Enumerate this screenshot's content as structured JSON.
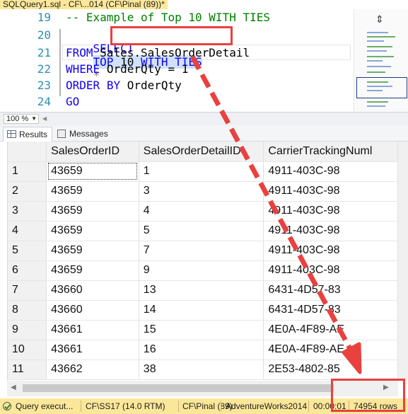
{
  "window": {
    "tab_title": "SQLQuery1.sql - CF\\...014 (CF\\Pinal (89))*",
    "close_glyph": "✕"
  },
  "editor": {
    "line_numbers": [
      "19",
      "20",
      "21",
      "22",
      "23",
      "24"
    ],
    "line19_comment": "-- Example of Top 10 WITH TIES",
    "line20": {
      "kw1": "SELECT",
      "top": "TOP",
      "num": "10",
      "with": "WITH",
      "ties": "TIES",
      "star": "*"
    },
    "line21": {
      "kw": "FROM",
      "rest": "Sales.SalesOrderDetail"
    },
    "line22": {
      "kw": "WHERE",
      "rest": "OrderQty = 1"
    },
    "line23": {
      "kw1": "ORDER",
      "kw2": "BY",
      "rest": "OrderQty"
    },
    "line24": {
      "kw": "GO"
    }
  },
  "zoom": {
    "value": "100 %"
  },
  "result_tabs": [
    {
      "label": "Results",
      "icon": "grid-icon"
    },
    {
      "label": "Messages",
      "icon": "messages-icon"
    }
  ],
  "grid": {
    "columns": [
      "SalesOrderID",
      "SalesOrderDetailID",
      "CarrierTrackingNumber"
    ],
    "column_display": [
      "SalesOrderID",
      "SalesOrderDetailID",
      "CarrierTrackingNuml"
    ],
    "rows": [
      [
        "1",
        "43659",
        "1",
        "4911-403C-98"
      ],
      [
        "2",
        "43659",
        "3",
        "4911-403C-98"
      ],
      [
        "3",
        "43659",
        "4",
        "4911-403C-98"
      ],
      [
        "4",
        "43659",
        "5",
        "4911-403C-98"
      ],
      [
        "5",
        "43659",
        "7",
        "4911-403C-98"
      ],
      [
        "6",
        "43659",
        "9",
        "4911-403C-98"
      ],
      [
        "7",
        "43660",
        "13",
        "6431-4D57-83"
      ],
      [
        "8",
        "43660",
        "14",
        "6431-4D57-83"
      ],
      [
        "9",
        "43661",
        "15",
        "4E0A-4F89-AE"
      ],
      [
        "10",
        "43661",
        "16",
        "4E0A-4F89-AE"
      ],
      [
        "11",
        "43662",
        "38",
        "2E53-4802-85"
      ]
    ]
  },
  "status": {
    "query": "Query execut...",
    "server": "CF\\SS17 (14.0 RTM)",
    "user": "CF\\Pinal (89)",
    "database": "AdventureWorks2014",
    "time": "00:00:01",
    "rows": "74954 rows"
  },
  "colors": {
    "annotation_red": "#e8413f",
    "status_bar": "#fbe799",
    "keyword_blue": "#1100ee",
    "comment_green": "#008000"
  }
}
